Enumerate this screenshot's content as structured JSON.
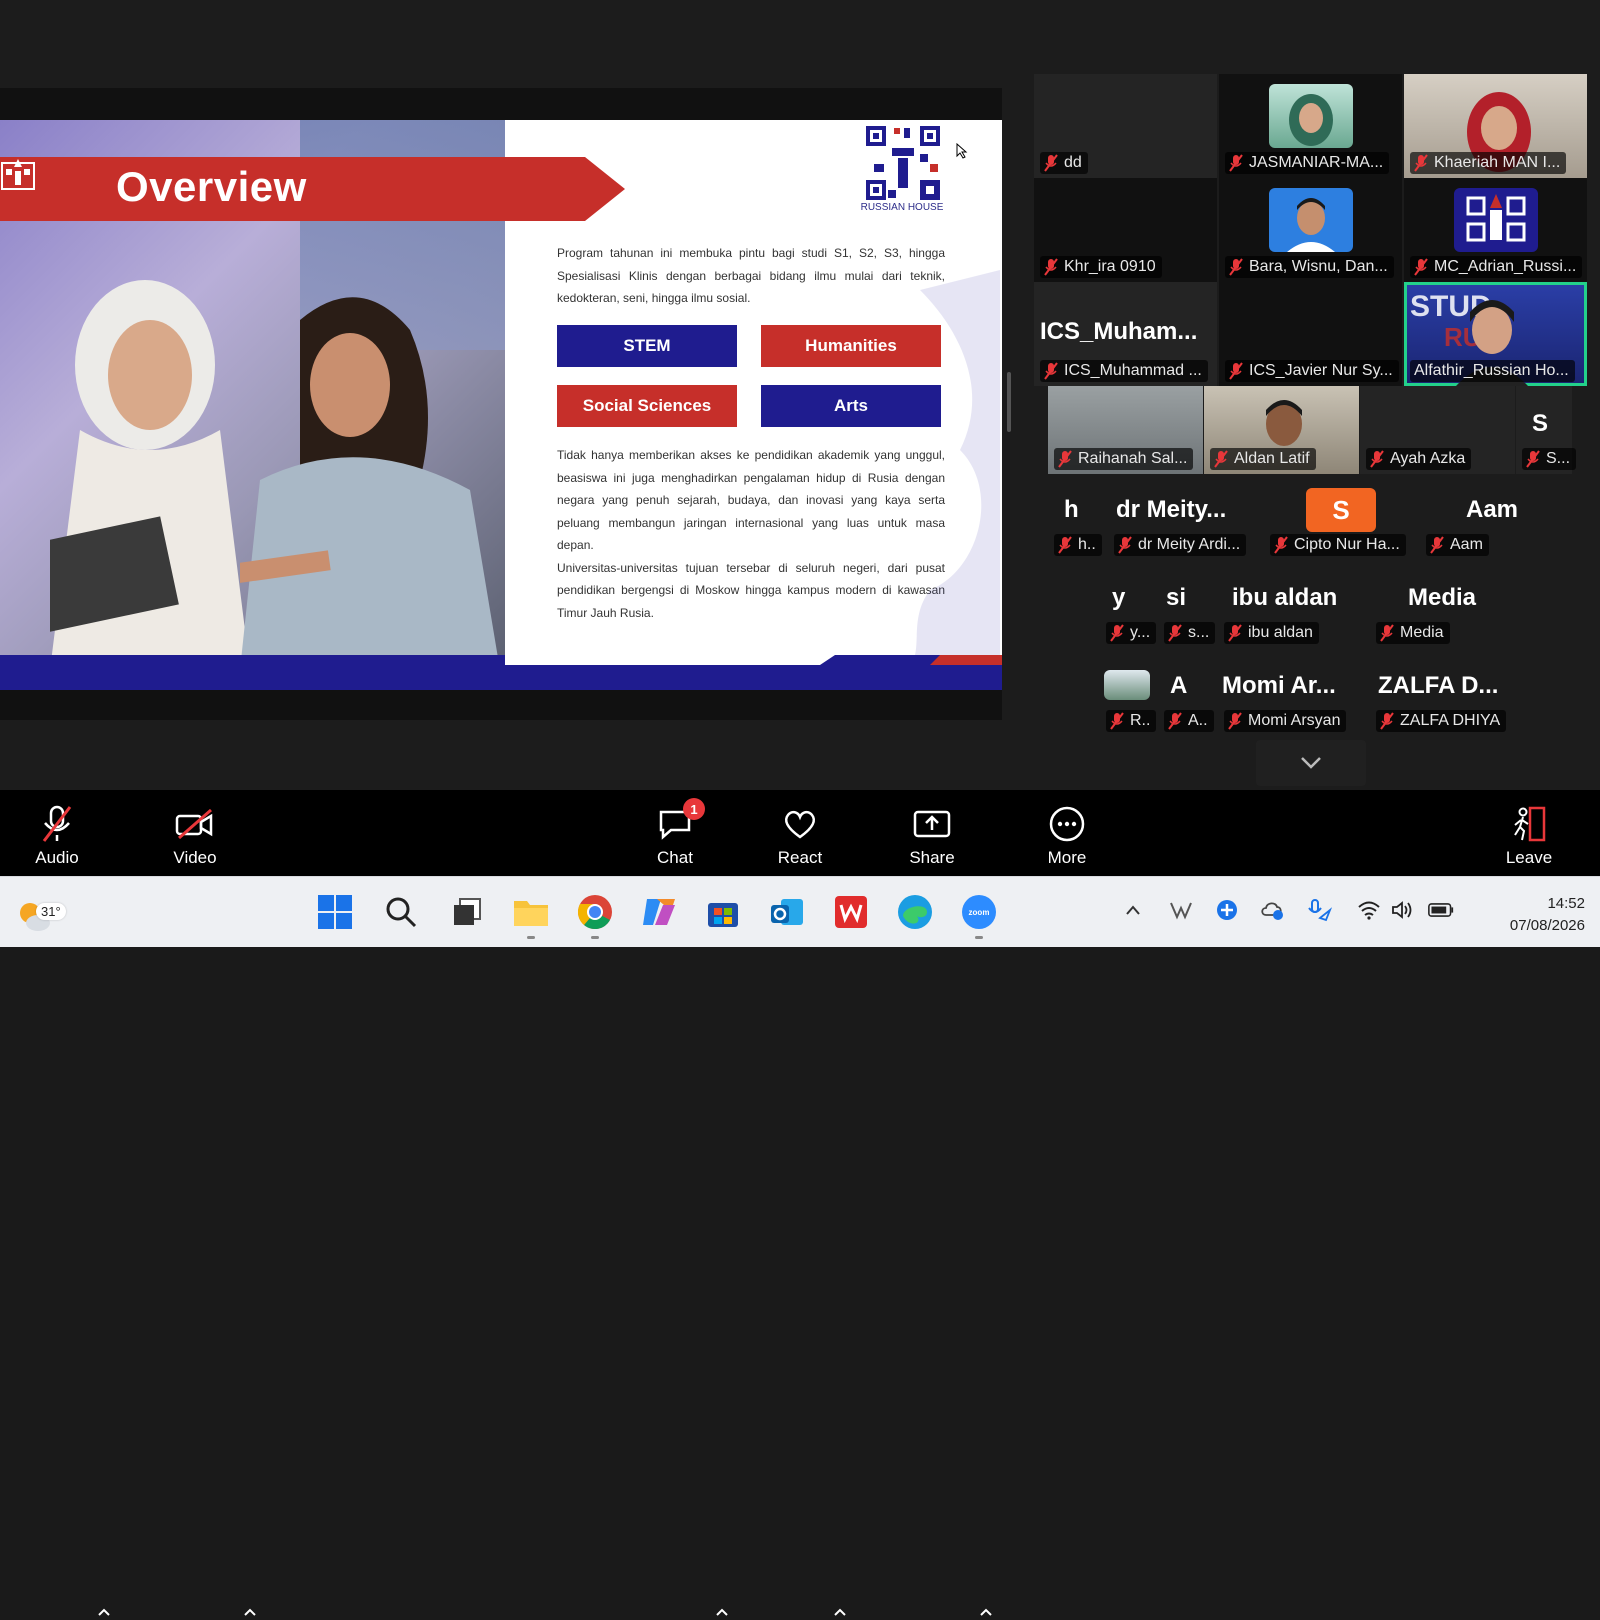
{
  "slide": {
    "title": "Overview",
    "qr_caption": "RUSSIAN HOUSE",
    "intro": "Program tahunan ini membuka pintu bagi studi S1, S2, S3, hingga Spesialisasi Klinis dengan berbagai bidang ilmu mulai dari teknik, kedokteran, seni, hingga ilmu sosial.",
    "tags": [
      "STEM",
      "Humanities",
      "Social Sciences",
      "Arts"
    ],
    "body1": "Tidak hanya memberikan akses ke pendidikan akademik yang unggul, beasiswa ini juga menghadirkan pengalaman hidup di Rusia dengan negara yang penuh sejarah, budaya, dan inovasi yang kaya serta peluang membangun jaringan internasional yang luas untuk masa depan.",
    "body2": "Universitas-universitas tujuan tersebar di seluruh negeri, dari pusat pendidikan bergengsi di Moskow hingga kampus modern di kawasan Timur Jauh Rusia."
  },
  "participants": {
    "dd": "dd",
    "jasmaniar": "JASMANIAR-MA...",
    "khaeriah": "Khaeriah MAN I...",
    "khr_ira": "Khr_ira 0910",
    "bara": "Bara, Wisnu, Dan...",
    "mc_adrian": "MC_Adrian_Russi...",
    "ics_muham_big": "ICS_Muham...",
    "ics_muhammad": "ICS_Muhammad ...",
    "ics_javier": "ICS_Javier Nur Sy...",
    "alfathir": "Alfathir_Russian Ho...",
    "raihanah": "Raihanah Sal...",
    "aldan": "Aldan Latif",
    "ayah_azka": "Ayah Azka",
    "s_big": "S",
    "s_small": "S...",
    "h_big": "h",
    "h_small": "h..",
    "meity_big": "dr  Meity...",
    "meity": "dr Meity Ardi...",
    "cipto_avatar": "S",
    "cipto": "Cipto Nur Ha...",
    "aam_big": "Aam",
    "aam": "Aam",
    "y_big": "y",
    "y_small": "y...",
    "si_big": "si",
    "si_small": "s...",
    "ibu_aldan_big": "ibu aldan",
    "ibu_aldan": "ibu aldan",
    "media_big": "Media",
    "media": "Media",
    "r_small": "R..",
    "a_big": "A",
    "a_small": "A..",
    "momi_big": "Momi Ar...",
    "momi": "Momi Arsyan",
    "zalfa_big": "ZALFA D...",
    "zalfa": "ZALFA DHIYA"
  },
  "toolbar": {
    "audio": "Audio",
    "video": "Video",
    "chat": "Chat",
    "chat_badge": "1",
    "react": "React",
    "share": "Share",
    "more": "More",
    "leave": "Leave"
  },
  "taskbar": {
    "temperature": "31°",
    "time": "14:52",
    "date": "07/08/2026"
  },
  "colors": {
    "stem_blue": "#1f1c8f",
    "humanities_red": "#c62f2a",
    "active_speaker": "#23d18b",
    "leave_red": "#e8373a"
  }
}
